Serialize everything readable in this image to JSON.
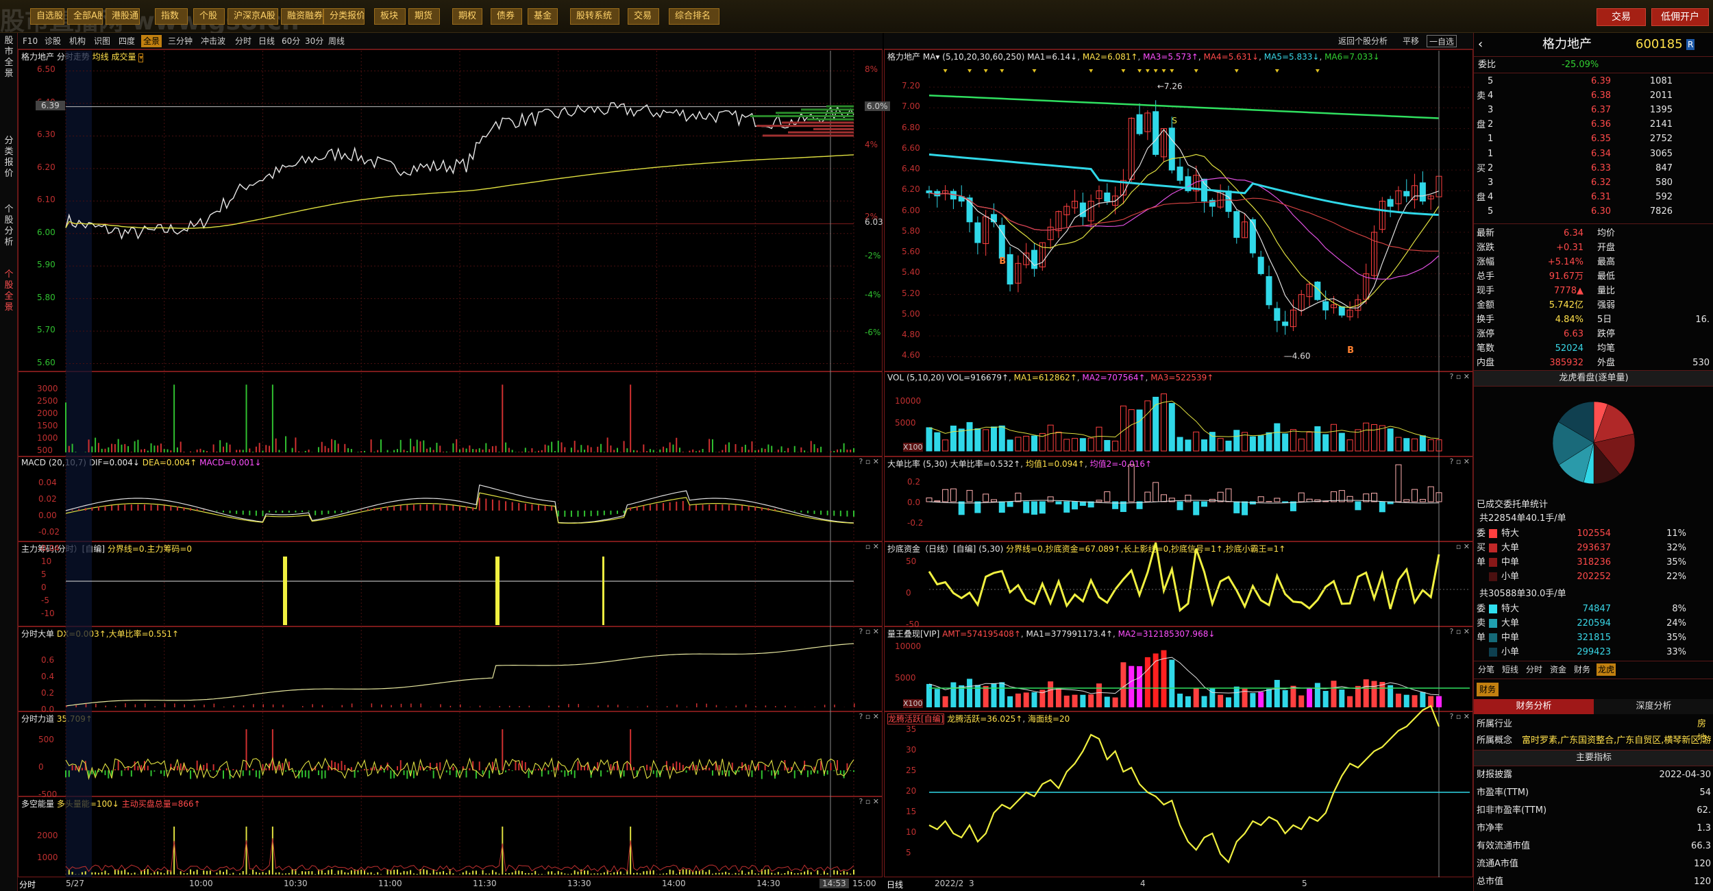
{
  "topbar": {
    "buttons": [
      "自选股",
      "全部A股",
      "港股通",
      "指数",
      "个股",
      "沪深京A股",
      "融资融券",
      "分类报价",
      "板块",
      "期货",
      "期权",
      "债券",
      "基金",
      "股转系统",
      "交易",
      "综合排名"
    ],
    "trade": "交易",
    "open_account": "低佣开户",
    "watermark": "股市直播网 www.gs8.cn"
  },
  "left_tabs": [
    "股市全景",
    "分类报价",
    "个股分析",
    "个股全景"
  ],
  "toolbar": {
    "items": [
      "F10",
      "诊股",
      "机构",
      "识图",
      "四度",
      "全景",
      "三分钟",
      "冲击波",
      "分时",
      "日线",
      "60分",
      "30分",
      "周线"
    ],
    "selected": "全景",
    "right_items": [
      "返回个股分析",
      "平移",
      "一自选"
    ]
  },
  "intraday": {
    "title": "格力地产",
    "subtitle": "分时走势",
    "legend": "均线 成交量",
    "price_labels": [
      "6.50",
      "6.40",
      "6.30",
      "6.20",
      "6.10",
      "6.00",
      "5.90",
      "5.80",
      "5.70",
      "5.60"
    ],
    "current_price": "6.39",
    "pct_labels": [
      "8%",
      "6.0%",
      "4%",
      "2%",
      "6.03",
      "-2%",
      "-4%",
      "-6%"
    ],
    "vol_labels": [
      "3000",
      "2500",
      "2000",
      "1500",
      "1000",
      "500"
    ],
    "times": [
      "5/27",
      "10:00",
      "10:30",
      "11:00",
      "11:30",
      "13:30",
      "14:00",
      "14:30",
      "14:53",
      "15:00"
    ],
    "bottom_tab": "分时",
    "macd": {
      "title": "MACD",
      "params": "(20,10,7)",
      "dif": "DIF=0.004↓",
      "dea": "DEA=0.004↑",
      "macd": "MACD=0.001↓",
      "labels": [
        "0.04",
        "0.02",
        "0.00",
        "-0.02",
        "-0.04"
      ]
    },
    "zljm": {
      "title": "主力筹码(分时）[自编]",
      "value": "分界线=0.主力筹码=0",
      "labels": [
        "10",
        "5",
        "0",
        "-5",
        "-10"
      ]
    },
    "fsdd": {
      "title": "分时大单",
      "value": "DX=0.003↑,大单比率=0.551↑",
      "labels": [
        "0.6",
        "0.4",
        "0.2",
        "0.0"
      ]
    },
    "fsld": {
      "title": "分时力道",
      "value": "35.709↑",
      "labels": [
        "500",
        "0",
        "-500"
      ]
    },
    "dkl": {
      "title": "多空能量",
      "v1": "多头量能=100↓",
      "v2": "主动买盘总量=866↑",
      "labels": [
        "2000",
        "1000"
      ]
    }
  },
  "daily": {
    "title": "格力地产",
    "ma_label": "MA",
    "ma_params": "(5,10,20,30,60,250)",
    "ma_values": [
      "MA1=6.14↓",
      "MA2=6.081↑",
      "MA3=5.573↑",
      "MA4=5.631↓",
      "MA5=5.833↓",
      "MA6=7.033↓"
    ],
    "price_labels": [
      "7.20",
      "7.00",
      "6.80",
      "6.60",
      "6.40",
      "6.20",
      "6.00",
      "5.80",
      "5.60",
      "5.40",
      "5.20",
      "5.00",
      "4.80",
      "4.60"
    ],
    "annot_high": "7.26",
    "annot_low": "4.60",
    "buy_marks": [
      "B",
      "B"
    ],
    "sell_mark": "S",
    "vol": {
      "title": "VOL",
      "params": "(5,10,20)",
      "v": "VOL=916679↑",
      "ma": [
        "MA1=612862↑",
        "MA2=707564↑",
        "MA3=522539↑"
      ],
      "labels": [
        "10000",
        "5000"
      ],
      "unit": "X100"
    },
    "ddbl": {
      "title": "大单比率",
      "params": "(5,30)",
      "v": "大单比率=0.532↑",
      "m1": "均值1=0.094↑",
      "m2": "均值2=-0.016↑",
      "labels": [
        "0.2",
        "0.0",
        "-0.2"
      ]
    },
    "cdzj": {
      "title": "抄底资金（日线）[自编]",
      "params": "(5,30)",
      "v": "分界线=0,抄底资金=67.089↑,长上影线=0,抄底信号=1↑,抄底小霸王=1↑",
      "labels": [
        "50",
        "0",
        "-50"
      ]
    },
    "lwdx": {
      "title": "量王叠现[VIP]",
      "v": "AMT=574195408↑",
      "m1": "MA1=377991173.4↑",
      "m2": "MA2=312185307.968↓",
      "labels": [
        "10000",
        "5000"
      ],
      "unit": "X100"
    },
    "lthy": {
      "title": "龙腾活跃[自编]",
      "v": "龙腾活跃=36.025↑",
      "h": "海面线=20",
      "labels": [
        "35",
        "30",
        "25",
        "20",
        "15",
        "10",
        "5"
      ]
    },
    "dates": [
      "2022/2",
      "3",
      "4",
      "5"
    ],
    "bottom_tab": "日线"
  },
  "info": {
    "name": "格力地产",
    "code": "600185",
    "webi_label": "委比",
    "webi": "-25.09%",
    "webi_right": "",
    "sells": [
      {
        "l": "5",
        "p": "6.39",
        "v": "1081"
      },
      {
        "l": "4",
        "p": "6.38",
        "v": "2011"
      },
      {
        "l": "3",
        "p": "6.37",
        "v": "1395"
      },
      {
        "l": "2",
        "p": "6.36",
        "v": "2141"
      },
      {
        "l": "1",
        "p": "6.35",
        "v": "2752"
      }
    ],
    "buys": [
      {
        "l": "1",
        "p": "6.34",
        "v": "3065"
      },
      {
        "l": "2",
        "p": "6.33",
        "v": "847"
      },
      {
        "l": "3",
        "p": "6.32",
        "v": "580"
      },
      {
        "l": "4",
        "p": "6.31",
        "v": "592"
      },
      {
        "l": "5",
        "p": "6.30",
        "v": "7826"
      }
    ],
    "sell_side": "卖",
    "pan": "盘",
    "buy_side": "买",
    "stats": [
      {
        "k": "最新",
        "v": "6.34",
        "k2": "均价",
        "v2": ""
      },
      {
        "k": "涨跌",
        "v": "+0.31",
        "k2": "开盘",
        "v2": ""
      },
      {
        "k": "涨幅",
        "v": "+5.14%",
        "k2": "最高",
        "v2": ""
      },
      {
        "k": "总手",
        "v": "91.67万",
        "k2": "最低",
        "v2": ""
      },
      {
        "k": "现手",
        "v": "7778▲",
        "k2": "量比",
        "v2": ""
      },
      {
        "k": "金额",
        "v": "5.742亿",
        "k2": "强弱",
        "v2": ""
      },
      {
        "k": "换手",
        "v": "4.84%",
        "k2": "5日",
        "v2": "16."
      },
      {
        "k": "涨停",
        "v": "6.63",
        "k2": "跌停",
        "v2": ""
      },
      {
        "k": "笔数",
        "v": "52024",
        "k2": "均笔",
        "v2": ""
      },
      {
        "k": "内盘",
        "v": "385932",
        "k2": "外盘",
        "v2": "530"
      }
    ],
    "pie_title": "龙虎看盘(逐单量)",
    "order_title": "已成交委托单统计",
    "buy_summary": "共22854单40.1手/单",
    "buy_rows": [
      {
        "n": "特大",
        "v": "102554",
        "p": "11%"
      },
      {
        "n": "大单",
        "v": "293637",
        "p": "32%"
      },
      {
        "n": "中单",
        "v": "318236",
        "p": "35%"
      },
      {
        "n": "小单",
        "v": "202252",
        "p": "22%"
      }
    ],
    "sell_summary": "共30588单30.0手/单",
    "sell_rows": [
      {
        "n": "特大",
        "v": "74847",
        "p": "8%"
      },
      {
        "n": "大单",
        "v": "220594",
        "p": "24%"
      },
      {
        "n": "中单",
        "v": "321815",
        "p": "35%"
      },
      {
        "n": "小单",
        "v": "299423",
        "p": "33%"
      }
    ],
    "buy_side_labels": [
      "委",
      "买",
      "单"
    ],
    "sell_side_labels": [
      "委",
      "卖",
      "单"
    ],
    "tabs": [
      "分笔",
      "短线",
      "分时",
      "资金",
      "财务",
      "龙虎"
    ],
    "fin_tab": "财务",
    "fin_subtabs": [
      "财务分析",
      "深度分析"
    ],
    "industry_k": "所属行业",
    "industry_v": "房地",
    "concept_k": "所属概念",
    "concept_v": "富时罗素,广东国资整合,广东自贸区,横琴新区,游",
    "main_index": "主要指标",
    "fin_rows": [
      {
        "k": "财报披露",
        "v": "2022-04-30"
      },
      {
        "k": "市盈率(TTM)",
        "v": "54"
      },
      {
        "k": "扣非市盈率(TTM)",
        "v": "62."
      },
      {
        "k": "市净率",
        "v": "1.3"
      },
      {
        "k": "有效流通市值",
        "v": "66.3"
      },
      {
        "k": "流通A市值",
        "v": "120"
      },
      {
        "k": "总市值",
        "v": "120"
      }
    ]
  },
  "colors": {
    "up": "#ff3a3a",
    "down": "#30d0d0",
    "bg": "#000000",
    "grid": "#6a1818",
    "accent": "#c28010"
  }
}
